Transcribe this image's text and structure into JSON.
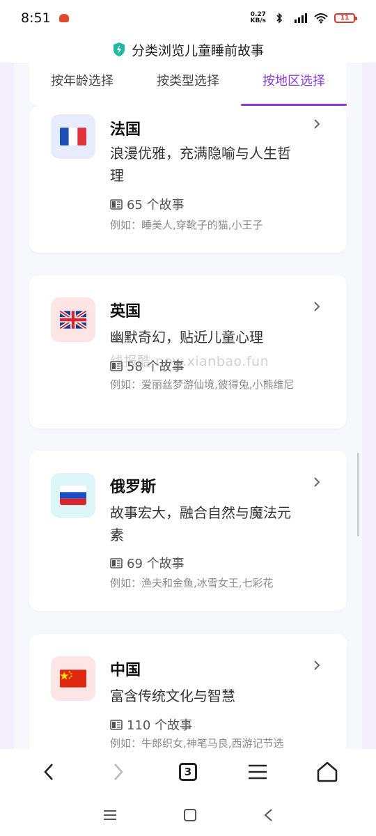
{
  "status_bar": {
    "time": "8:51",
    "net_speed_value": "0.27",
    "net_speed_unit": "KB/s",
    "battery": "11"
  },
  "title_bar": {
    "title": "分类浏览儿童睡前故事"
  },
  "tabs": [
    {
      "label": "按年龄选择",
      "active": false
    },
    {
      "label": "按类型选择",
      "active": false
    },
    {
      "label": "按地区选择",
      "active": true
    }
  ],
  "cards": [
    {
      "name": "法国",
      "flag": "france-flag-icon",
      "desc": "浪漫优雅，充满隐喻与人生哲理",
      "count": "65 个故事",
      "examples": "例如：睡美人,穿靴子的猫,小王子",
      "tint": "#e6ecfb"
    },
    {
      "name": "英国",
      "flag": "uk-flag-icon",
      "desc": "幽默奇幻，贴近儿童心理",
      "count": "58 个故事",
      "examples": "例如：爱丽丝梦游仙境,彼得兔,小熊维尼",
      "tint": "#fde5e5"
    },
    {
      "name": "俄罗斯",
      "flag": "russia-flag-icon",
      "desc": "故事宏大，融合自然与魔法元素",
      "count": "69 个故事",
      "examples": "例如：渔夫和金鱼,冰雪女王,七彩花",
      "tint": "#dcf6f8"
    },
    {
      "name": "中国",
      "flag": "china-flag-icon",
      "desc": "富含传统文化与智慧",
      "count": "110 个故事",
      "examples": "例如：牛郎织女,神笔马良,西游记节选",
      "tint": "#fde5e5"
    }
  ],
  "watermark": "线报酷 new.xianbao.fun",
  "browser_toolbar": {
    "tab_count": "3"
  },
  "colors": {
    "accent": "#8a3bd1",
    "shield": "#23b8a0"
  }
}
